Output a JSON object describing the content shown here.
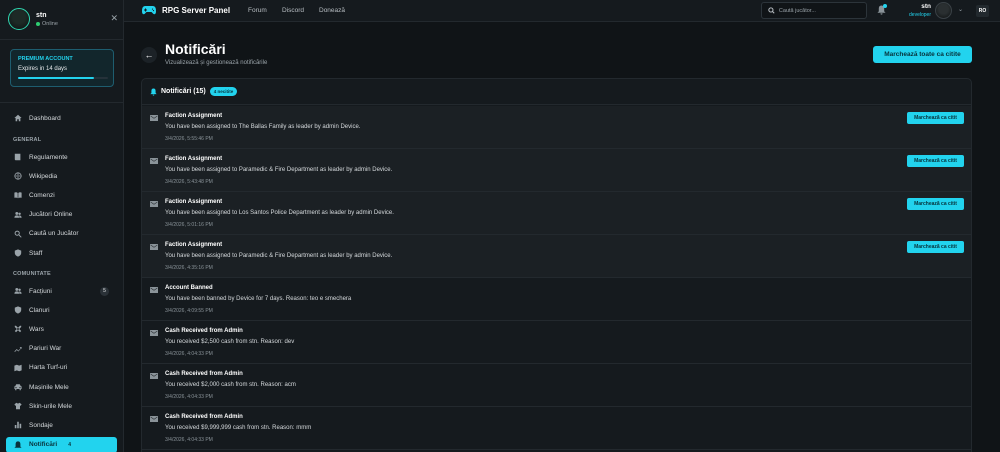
{
  "sidebar": {
    "user": {
      "name": "stn",
      "status": "Online"
    },
    "premium": {
      "title": "PREMIUM ACCOUNT",
      "expires": "Expires in 14 days",
      "progress": 0.84
    },
    "dashboard": "Dashboard",
    "section_general": "GENERAL",
    "general_items": [
      {
        "label": "Regulamente",
        "icon": "book-icon"
      },
      {
        "label": "Wikipedia",
        "icon": "globe-icon"
      },
      {
        "label": "Comenzi",
        "icon": "book-open-icon"
      },
      {
        "label": "Jucători Online",
        "icon": "users-icon"
      },
      {
        "label": "Caută un Jucător",
        "icon": "search-icon"
      },
      {
        "label": "Staff",
        "icon": "shield-icon"
      }
    ],
    "section_community": "COMUNITATE",
    "community_items": [
      {
        "label": "Facțiuni",
        "icon": "users-icon",
        "badge": "5"
      },
      {
        "label": "Clanuri",
        "icon": "shield-icon"
      },
      {
        "label": "Wars",
        "icon": "swords-icon"
      },
      {
        "label": "Pariuri War",
        "icon": "trend-icon"
      },
      {
        "label": "Harta Turf-uri",
        "icon": "map-icon"
      },
      {
        "label": "Mașinile Mele",
        "icon": "car-icon"
      },
      {
        "label": "Skin-urile Mele",
        "icon": "shirt-icon"
      },
      {
        "label": "Sondaje",
        "icon": "bar-chart-icon"
      },
      {
        "label": "Notificări",
        "icon": "bell-icon",
        "badge": "4",
        "active": true
      }
    ]
  },
  "topbar": {
    "brand": "RPG Server Panel",
    "links": [
      "Forum",
      "Discord",
      "Donează"
    ],
    "search_placeholder": "Caută jucător...",
    "user_name": "stn",
    "user_role": "developer",
    "lang": "RO"
  },
  "page": {
    "title": "Notificări",
    "subtitle": "Vizualizează și gestionează notificările",
    "mark_all_label": "Marchează toate ca citite"
  },
  "panel": {
    "title": "Notificări (15)",
    "unread_pill": "4 necitite",
    "mark_read_label": "Marchează ca citit",
    "notifications": [
      {
        "title": "Faction Assignment",
        "message": "You have been assigned to The Ballas Family as leader by admin Device.",
        "time": "3/4/2026, 5:55:46 PM",
        "unread": true
      },
      {
        "title": "Faction Assignment",
        "message": "You have been assigned to Paramedic & Fire Department as leader by admin Device.",
        "time": "3/4/2026, 5:43:48 PM",
        "unread": true
      },
      {
        "title": "Faction Assignment",
        "message": "You have been assigned to Los Santos Police Department as leader by admin Device.",
        "time": "3/4/2026, 5:01:16 PM",
        "unread": true
      },
      {
        "title": "Faction Assignment",
        "message": "You have been assigned to Paramedic & Fire Department as leader by admin Device.",
        "time": "3/4/2026, 4:35:16 PM",
        "unread": true
      },
      {
        "title": "Account Banned",
        "message": "You have been banned by Device for 7 days. Reason: teo e smechera",
        "time": "3/4/2026, 4:09:55 PM",
        "unread": false
      },
      {
        "title": "Cash Received from Admin",
        "message": "You received $2,500 cash from stn. Reason: dev",
        "time": "3/4/2026, 4:04:33 PM",
        "unread": false
      },
      {
        "title": "Cash Received from Admin",
        "message": "You received $2,000 cash from stn. Reason: acm",
        "time": "3/4/2026, 4:04:33 PM",
        "unread": false
      },
      {
        "title": "Cash Received from Admin",
        "message": "You received $9,999,999 cash from stn. Reason: mmm",
        "time": "3/4/2026, 4:04:33 PM",
        "unread": false
      }
    ]
  },
  "colors": {
    "accent": "#22d3ee",
    "online": "#2ecc71",
    "background": "#101417",
    "surface": "#151a1e"
  }
}
